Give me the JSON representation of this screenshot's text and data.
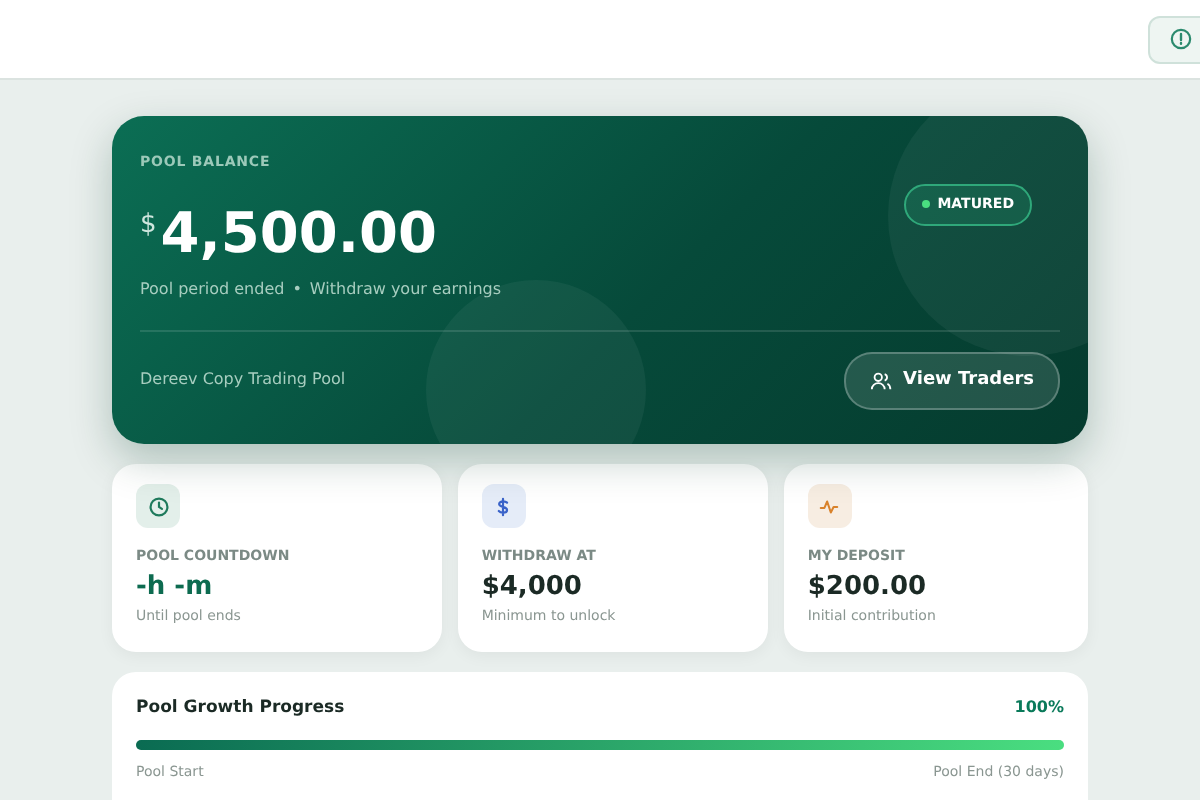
{
  "balance": {
    "label": "POOL BALANCE",
    "status": "MATURED",
    "currency": "$",
    "amount": "4,500.00",
    "subtitle": "Pool period ended",
    "separator": "•",
    "subtitle_2": "Withdraw your earnings",
    "pool_name": "Dereev Copy Trading Pool",
    "button": "View Traders"
  },
  "stats": [
    {
      "kind": "clock",
      "label": "POOL COUNTDOWN",
      "value": "-h -m",
      "note": "Until pool ends"
    },
    {
      "kind": "dollar",
      "label": "WITHDRAW AT",
      "value": "$4,000",
      "note": "Minimum to unlock"
    },
    {
      "kind": "pulse",
      "label": "MY DEPOSIT",
      "value": "$200.00",
      "note": "Initial contribution"
    }
  ],
  "progress": {
    "title": "Pool Growth Progress",
    "percent": "100%",
    "level": 1.0,
    "start": "Pool Start",
    "end": "Pool End (30 days)"
  }
}
